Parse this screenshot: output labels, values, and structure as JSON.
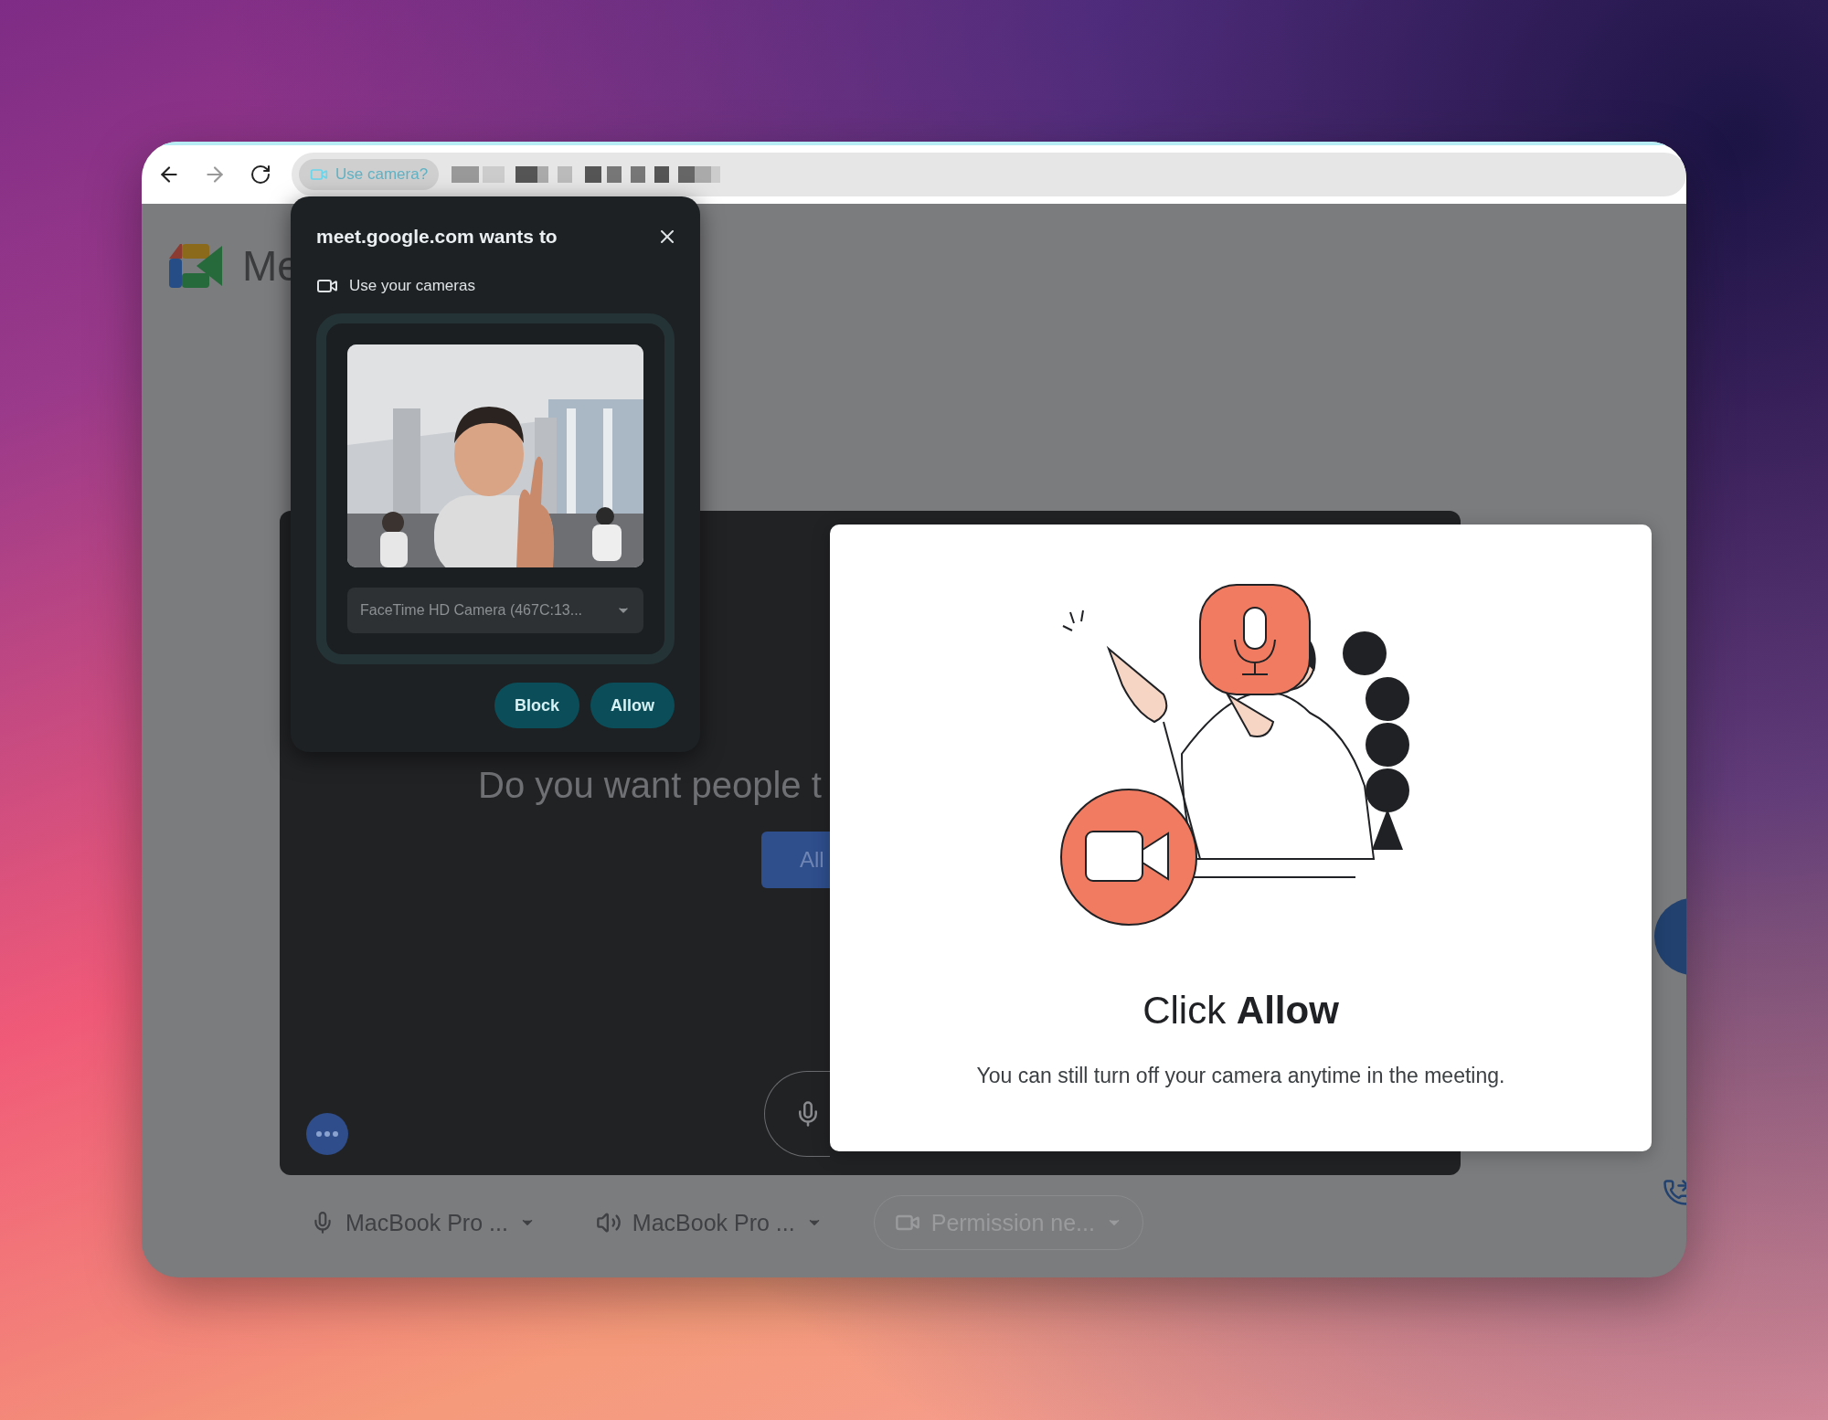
{
  "browser": {
    "address_chip": {
      "label": "Use camera?"
    }
  },
  "meet_page": {
    "logo_text": "Me",
    "prompt": "Do you want people t",
    "allow_button": "All",
    "devices": [
      {
        "kind": "mic",
        "label": "MacBook Pro ...",
        "disabled": false
      },
      {
        "kind": "speaker",
        "label": "MacBook Pro ...",
        "disabled": false
      },
      {
        "kind": "camera",
        "label": "Permission ne...",
        "disabled": true
      }
    ]
  },
  "permission_popup": {
    "title": "meet.google.com wants to",
    "permission": "Use your cameras",
    "camera_select": "FaceTime HD Camera (467C:13...",
    "buttons": [
      "Block",
      "Allow"
    ]
  },
  "help_card": {
    "title": "Click **Allow**",
    "text": "You can still turn off your camera anytime in the meeting."
  }
}
